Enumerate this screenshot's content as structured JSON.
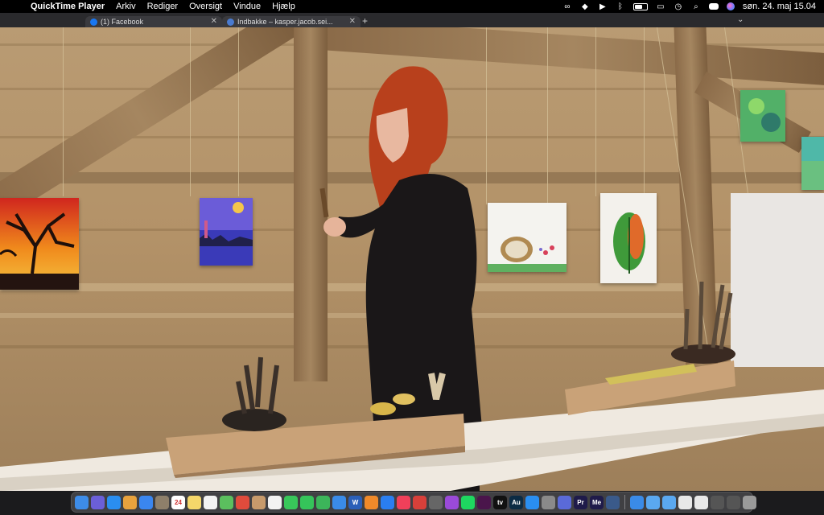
{
  "menubar": {
    "app_name": "QuickTime Player",
    "items": [
      "Arkiv",
      "Rediger",
      "Oversigt",
      "Vindue",
      "Hjælp"
    ],
    "clock": "søn. 24. maj  15.04",
    "status_icons": [
      "creative-cloud-icon",
      "dropbox-icon",
      "play-icon",
      "bluetooth-icon",
      "battery-icon",
      "screen-mirroring-icon",
      "time-machine-icon",
      "spotlight-icon",
      "control-center-icon",
      "siri-icon"
    ]
  },
  "browser_tabs": [
    {
      "title": "(1) Facebook",
      "favicon_color": "#1877f2"
    },
    {
      "title": "Indbakke – kasper.jacob.sei...",
      "favicon_color": "#4a7bd0"
    }
  ],
  "dock": {
    "apps": [
      {
        "name": "finder-icon",
        "color": "#3d8ce8",
        "glyph": ""
      },
      {
        "name": "siri-icon",
        "color": "#6b5fd8",
        "glyph": ""
      },
      {
        "name": "safari-icon",
        "color": "#2a8ef0",
        "glyph": ""
      },
      {
        "name": "photos-icon",
        "color": "#e8a23d",
        "glyph": ""
      },
      {
        "name": "mail-icon",
        "color": "#3a86f0",
        "glyph": ""
      },
      {
        "name": "files-icon",
        "color": "#8e7f6a",
        "glyph": ""
      },
      {
        "name": "calendar-icon",
        "color": "#ffffff",
        "glyph": "24"
      },
      {
        "name": "notes-icon",
        "color": "#f5d76a",
        "glyph": ""
      },
      {
        "name": "reminders-icon",
        "color": "#f2f2f2",
        "glyph": ""
      },
      {
        "name": "maps-icon",
        "color": "#5bbf5e",
        "glyph": ""
      },
      {
        "name": "chrome-icon",
        "color": "#e04b3c",
        "glyph": ""
      },
      {
        "name": "contacts-icon",
        "color": "#c79a6b",
        "glyph": ""
      },
      {
        "name": "slack-icon",
        "color": "#f2f2f2",
        "glyph": ""
      },
      {
        "name": "messages-icon",
        "color": "#38c75a",
        "glyph": ""
      },
      {
        "name": "facetime-icon",
        "color": "#35c45a",
        "glyph": ""
      },
      {
        "name": "numbers-icon",
        "color": "#3cb55a",
        "glyph": ""
      },
      {
        "name": "keynote-icon",
        "color": "#3a8be8",
        "glyph": ""
      },
      {
        "name": "word-icon",
        "color": "#2b5fb8",
        "glyph": "W"
      },
      {
        "name": "books-icon",
        "color": "#f08a2a",
        "glyph": ""
      },
      {
        "name": "dropbox-icon",
        "color": "#2a7ef0",
        "glyph": ""
      },
      {
        "name": "music-icon",
        "color": "#f0405a",
        "glyph": ""
      },
      {
        "name": "photo-booth-icon",
        "color": "#d8403a",
        "glyph": ""
      },
      {
        "name": "brush-icon",
        "color": "#666666",
        "glyph": ""
      },
      {
        "name": "podcasts-icon",
        "color": "#9a4ad8",
        "glyph": ""
      },
      {
        "name": "spotify-icon",
        "color": "#1ed760",
        "glyph": ""
      },
      {
        "name": "slack-app-icon",
        "color": "#4a154b",
        "glyph": ""
      },
      {
        "name": "apple-tv-icon",
        "color": "#111111",
        "glyph": "tv"
      },
      {
        "name": "audition-icon",
        "color": "#0b2b44",
        "glyph": "Au"
      },
      {
        "name": "app-store-icon",
        "color": "#2a8ef0",
        "glyph": ""
      },
      {
        "name": "system-preferences-icon",
        "color": "#8a8a8a",
        "glyph": ""
      },
      {
        "name": "vpn-icon",
        "color": "#5a6ad8",
        "glyph": ""
      },
      {
        "name": "premiere-icon",
        "color": "#1f1b4a",
        "glyph": "Pr"
      },
      {
        "name": "media-encoder-icon",
        "color": "#1f1b4a",
        "glyph": "Me"
      },
      {
        "name": "quicktime-icon",
        "color": "#3a5a8a",
        "glyph": ""
      }
    ],
    "recents": [
      {
        "name": "globe-icon",
        "color": "#3a8be8"
      },
      {
        "name": "folder-icon",
        "color": "#5aa8f0"
      },
      {
        "name": "folder-icon",
        "color": "#5aa8f0"
      },
      {
        "name": "document-icon",
        "color": "#e8e8e8"
      },
      {
        "name": "document-icon",
        "color": "#e8e8e8"
      },
      {
        "name": "stack-icon",
        "color": "#555555"
      },
      {
        "name": "stack-icon",
        "color": "#555555"
      },
      {
        "name": "trash-icon",
        "color": "#9a9a9a"
      }
    ]
  }
}
